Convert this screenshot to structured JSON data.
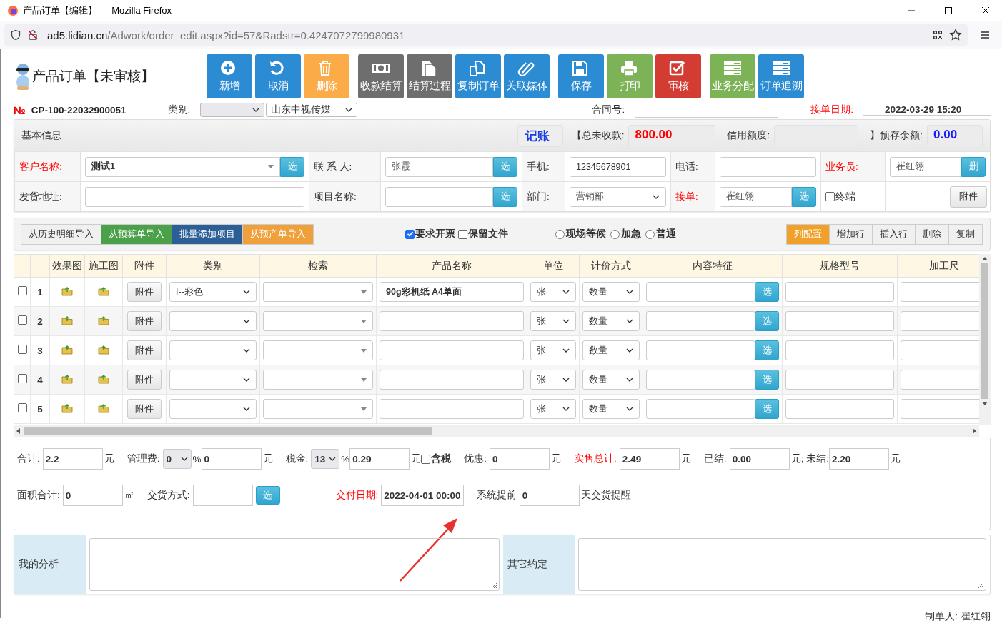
{
  "window": {
    "title": "产品订单【编辑】 — Mozilla Firefox",
    "url_host": "ad5.lidian.cn",
    "url_path": "/Adwork/order_edit.aspx?id=57&Radstr=0.4247072799980931"
  },
  "header": {
    "title": "产品订单【未审核】",
    "button_groups": [
      [
        {
          "label": "新增",
          "kind": "add",
          "color": "#2b8bd3"
        },
        {
          "label": "取消",
          "kind": "undo",
          "color": "#2b8bd3"
        },
        {
          "label": "删除",
          "kind": "trash",
          "color": "#fbab48"
        }
      ],
      [
        {
          "label": "收款结算",
          "kind": "money",
          "color": "#6e6e6e"
        },
        {
          "label": "结算过程",
          "kind": "document",
          "color": "#6e6e6e"
        },
        {
          "label": "复制订单",
          "kind": "copy",
          "color": "#2b8bd3"
        },
        {
          "label": "关联媒体",
          "kind": "clip",
          "color": "#2b8bd3"
        }
      ],
      [
        {
          "label": "保存",
          "kind": "save",
          "color": "#2b8bd3"
        },
        {
          "label": "打印",
          "kind": "print",
          "color": "#7bb356"
        },
        {
          "label": "审核",
          "kind": "approve",
          "color": "#d23c33"
        }
      ],
      [
        {
          "label": "业务分配",
          "kind": "list",
          "color": "#7bb356"
        },
        {
          "label": "订单追溯",
          "kind": "list",
          "color": "#2b8bd3"
        }
      ]
    ]
  },
  "order": {
    "number_mark": "№",
    "number": "CP-100-22032900051",
    "category_label": "类别:",
    "company": "山东中视传媒",
    "contract_label": "合同号:",
    "date_label": "接单日期:",
    "date": "2022-03-29 15:20"
  },
  "basic_info": {
    "title": "基本信息",
    "account": "记账",
    "unpaid_label": "【总未收款:",
    "unpaid": "800.00",
    "credit_label": "信用额度:",
    "balance_label": "】预存余额:",
    "balance": "0.00",
    "rows": [
      [
        {
          "kind": "label",
          "text": "客户名称:",
          "emphasis": true
        },
        {
          "kind": "combo",
          "value": "测试1",
          "button": "选"
        },
        {
          "kind": "label",
          "text": "联 系 人:",
          "emphasis": false
        },
        {
          "kind": "pick",
          "value": "张霞",
          "button": "选"
        },
        {
          "kind": "label",
          "text": "手机:",
          "emphasis": false
        },
        {
          "kind": "input",
          "value": "12345678901"
        },
        {
          "kind": "label",
          "text": "电话:",
          "emphasis": false
        },
        {
          "kind": "input"
        },
        {
          "kind": "label",
          "text": "业务员:",
          "emphasis": true
        },
        {
          "kind": "pick",
          "value": "崔红翎",
          "button": "删"
        }
      ],
      [
        {
          "kind": "label",
          "text": "发货地址:",
          "emphasis": false
        },
        {
          "kind": "input"
        },
        {
          "kind": "label",
          "text": "项目名称:",
          "emphasis": false
        },
        {
          "kind": "pick",
          "button": "选"
        },
        {
          "kind": "label",
          "text": "部门:",
          "emphasis": false
        },
        {
          "kind": "dropdown",
          "value": "营销部"
        },
        {
          "kind": "label",
          "text": "接单:",
          "emphasis": true
        },
        {
          "kind": "pick",
          "value": "崔红翎",
          "button": "选"
        },
        {
          "kind": "check",
          "text": "终端",
          "checked": false
        },
        {
          "kind": "button",
          "text": "附件"
        }
      ]
    ]
  },
  "detail_toolbar": {
    "imports": [
      {
        "label": "从历史明细导入",
        "color": "#f0f0f0"
      },
      {
        "label": "从预算单导入",
        "color": "#4aa14a"
      },
      {
        "label": "批量添加项目",
        "color": "#2c5f96"
      },
      {
        "label": "从预产单导入",
        "color": "#f0a03a"
      }
    ],
    "checks": [
      {
        "label": "要求开票",
        "checked": true
      },
      {
        "label": "保留文件",
        "checked": false
      }
    ],
    "radios": [
      {
        "label": "现场等候",
        "selected": false
      },
      {
        "label": "加急",
        "selected": false
      },
      {
        "label": "普通",
        "selected": false
      }
    ],
    "actions": [
      {
        "label": "列配置",
        "color": "#f1a02a"
      },
      {
        "label": "增加行",
        "color": "#f0f0f0"
      },
      {
        "label": "插入行",
        "color": "#f0f0f0"
      },
      {
        "label": "删除",
        "color": "#f0f0f0"
      },
      {
        "label": "复制",
        "color": "#f0f0f0"
      }
    ]
  },
  "table": {
    "columns": [
      {
        "kind": "check"
      },
      {
        "kind": "index"
      },
      {
        "label": "效果图",
        "kind": "image"
      },
      {
        "label": "施工图",
        "kind": "image"
      },
      {
        "label": "附件",
        "kind": "button"
      },
      {
        "label": "类别",
        "kind": "dropdown"
      },
      {
        "label": "检索",
        "kind": "combo"
      },
      {
        "label": "产品名称",
        "kind": "text"
      },
      {
        "label": "单位",
        "kind": "dropdown"
      },
      {
        "label": "计价方式",
        "kind": "dropdown"
      },
      {
        "label": "内容特征",
        "kind": "textpick"
      },
      {
        "label": "规格型号",
        "kind": "text"
      },
      {
        "label": "加工尺",
        "kind": "text"
      }
    ],
    "rows": [
      {
        "checked": false,
        "cells": [
          null,
          "1",
          null,
          null,
          "附件",
          "I--彩色",
          null,
          "90g彩机纸 A4单面",
          "张",
          "数量",
          "选",
          null,
          null
        ]
      },
      {
        "checked": false,
        "cells": [
          null,
          "2",
          null,
          null,
          "附件",
          null,
          null,
          null,
          "张",
          "数量",
          "选",
          null,
          null
        ]
      },
      {
        "checked": false,
        "cells": [
          null,
          "3",
          null,
          null,
          "附件",
          null,
          null,
          null,
          "张",
          "数量",
          "选",
          null,
          null
        ]
      },
      {
        "checked": false,
        "cells": [
          null,
          "4",
          null,
          null,
          "附件",
          null,
          null,
          null,
          "张",
          "数量",
          "选",
          null,
          null
        ]
      },
      {
        "checked": false,
        "cells": [
          null,
          "5",
          null,
          null,
          "附件",
          null,
          null,
          null,
          "张",
          "数量",
          "选",
          null,
          null
        ]
      }
    ]
  },
  "totals": [
    [
      {
        "kind": "label",
        "text": "合计:"
      },
      {
        "kind": "input",
        "value": "2.2"
      },
      {
        "kind": "unit",
        "text": "元"
      },
      {
        "kind": "label",
        "text": "管理费:"
      },
      {
        "kind": "select",
        "value": "0"
      },
      {
        "kind": "unit",
        "text": "%"
      },
      {
        "kind": "input",
        "value": "0"
      },
      {
        "kind": "unit",
        "text": "元"
      },
      {
        "kind": "label",
        "text": "税金:"
      },
      {
        "kind": "select",
        "value": "13"
      },
      {
        "kind": "unit",
        "text": "%"
      },
      {
        "kind": "input",
        "value": "0.29"
      },
      {
        "kind": "unit",
        "text": "元"
      },
      {
        "kind": "check",
        "text": "含税",
        "checked": false
      },
      {
        "kind": "label",
        "text": "优惠:"
      },
      {
        "kind": "input",
        "value": "0"
      },
      {
        "kind": "unit",
        "text": "元"
      },
      {
        "kind": "label",
        "text": "实售总计:",
        "emphasis": true
      },
      {
        "kind": "input",
        "value": "2.49"
      },
      {
        "kind": "unit",
        "text": "元"
      },
      {
        "kind": "label",
        "text": "已结:"
      },
      {
        "kind": "input",
        "value": "0.00"
      },
      {
        "kind": "unit",
        "text": "元; 未结:"
      },
      {
        "kind": "input",
        "value": "2.20"
      },
      {
        "kind": "unit",
        "text": "元"
      }
    ],
    [
      {
        "kind": "label",
        "text": "面积合计:"
      },
      {
        "kind": "input",
        "value": "0"
      },
      {
        "kind": "unit",
        "text": "㎡"
      },
      {
        "kind": "label",
        "text": "交货方式:"
      },
      {
        "kind": "input"
      },
      {
        "kind": "button",
        "text": "选"
      },
      {
        "kind": "label",
        "text": "交付日期:",
        "emphasis": true
      },
      {
        "kind": "input",
        "value": "2022-04-01 00:00"
      },
      {
        "kind": "label",
        "text": "系统提前"
      },
      {
        "kind": "input",
        "value": "0"
      },
      {
        "kind": "unit",
        "text": "天交货提醒"
      }
    ]
  ],
  "notes": [
    {
      "label": "我的分析"
    },
    {
      "label": "其它约定"
    }
  ],
  "footer": {
    "label": "制单人:",
    "value": "崔红翎"
  }
}
